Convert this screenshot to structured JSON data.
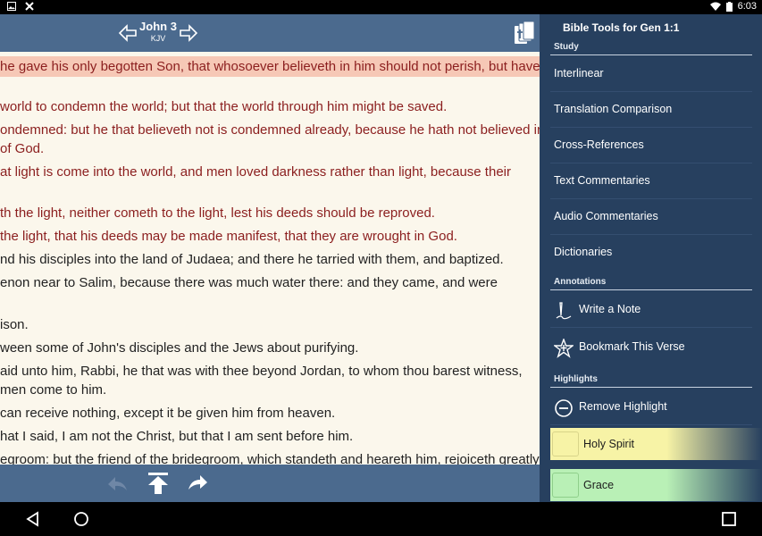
{
  "status": {
    "time": "6:03"
  },
  "reader": {
    "book": "John 3",
    "version": "KJV",
    "verses": [
      {
        "text": " he gave his only begotten Son, that whosoever believeth in him should not perish, but have",
        "color": "red",
        "highlight": true
      },
      {
        "text": " world to condemn the world; but that the world through him might be saved.",
        "color": "red"
      },
      {
        "text": "ondemned: but he that believeth not is condemned already, because he hath not believed in",
        "color": "red"
      },
      {
        "text": "of God.",
        "color": "red"
      },
      {
        "text": "at light is come into the world, and men loved darkness rather than light, because their",
        "color": "red"
      },
      {
        "text": "th the light, neither cometh to the light, lest his deeds should be reproved.",
        "color": "red"
      },
      {
        "text": " the light, that his deeds may be made manifest, that they are wrought in God.",
        "color": "red"
      },
      {
        "text": "nd his disciples into the land of Judaea; and there he tarried with them, and baptized.",
        "color": "blk"
      },
      {
        "text": "enon near to Salim, because there was much water there: and they came, and were",
        "color": "blk"
      },
      {
        "text": "ison.",
        "color": "blk"
      },
      {
        "text": "ween some of John's disciples and the Jews about purifying.",
        "color": "blk"
      },
      {
        "text": "aid unto him, Rabbi, he that was with thee beyond Jordan, to whom thou barest witness,",
        "color": "blk"
      },
      {
        "text": "men come to him.",
        "color": "blk"
      },
      {
        "text": "can receive nothing, except it be given him from heaven.",
        "color": "blk"
      },
      {
        "text": "hat I said, I am not the Christ, but that I am sent before him.",
        "color": "blk"
      },
      {
        "text": "egroom: but the friend of the bridegroom, which standeth and heareth him, rejoiceth greatly",
        "color": "blk"
      }
    ]
  },
  "panel": {
    "title": "Bible Tools for Gen 1:1",
    "study_label": "Study",
    "study_items": [
      "Interlinear",
      "Translation Comparison",
      "Cross-References",
      "Text Commentaries",
      "Audio Commentaries",
      "Dictionaries"
    ],
    "annotations_label": "Annotations",
    "write_note": "Write a Note",
    "bookmark": "Bookmark This Verse",
    "highlights_label": "Highlights",
    "remove_highlight": "Remove Highlight",
    "highlight_options": [
      {
        "label": "Holy Spirit",
        "color": "#F7F3A6"
      },
      {
        "label": "Grace",
        "color": "#B9F0B6"
      }
    ]
  }
}
